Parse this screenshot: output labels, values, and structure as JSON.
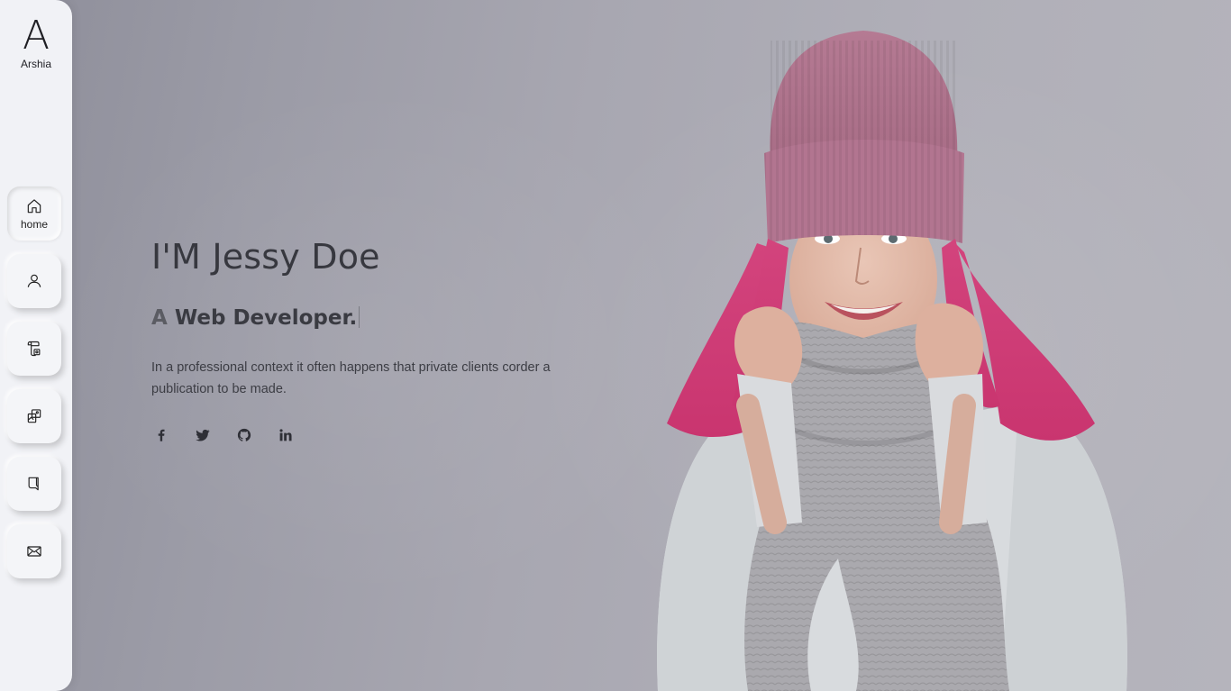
{
  "brand": {
    "mark": "A",
    "name": "Arshia"
  },
  "nav": {
    "items": [
      {
        "id": "home",
        "label": "home",
        "icon": "home-icon",
        "active": true
      },
      {
        "id": "about",
        "label": "",
        "icon": "user-icon",
        "active": false
      },
      {
        "id": "resume",
        "label": "",
        "icon": "resume-icon",
        "active": false
      },
      {
        "id": "portfolio",
        "label": "",
        "icon": "portfolio-icon",
        "active": false
      },
      {
        "id": "blog",
        "label": "",
        "icon": "blog-icon",
        "active": false
      },
      {
        "id": "contact",
        "label": "",
        "icon": "mail-icon",
        "active": false
      }
    ]
  },
  "hero": {
    "title": "I'M Jessy Doe",
    "subtitle_first": "A",
    "subtitle_rest": " Web Developer.",
    "description": "In a professional context it often happens that private clients corder a publication to be made."
  },
  "social": [
    {
      "name": "facebook",
      "icon": "facebook-icon"
    },
    {
      "name": "twitter",
      "icon": "twitter-icon"
    },
    {
      "name": "github",
      "icon": "github-icon"
    },
    {
      "name": "linkedin",
      "icon": "linkedin-icon"
    }
  ],
  "colors": {
    "sidebar_bg": "#f1f2f6",
    "text_dark": "#37383f",
    "hat": "#b57890",
    "hair": "#d9447c",
    "scarf": "#a9a8ad",
    "jacket": "#d9dcdf"
  }
}
